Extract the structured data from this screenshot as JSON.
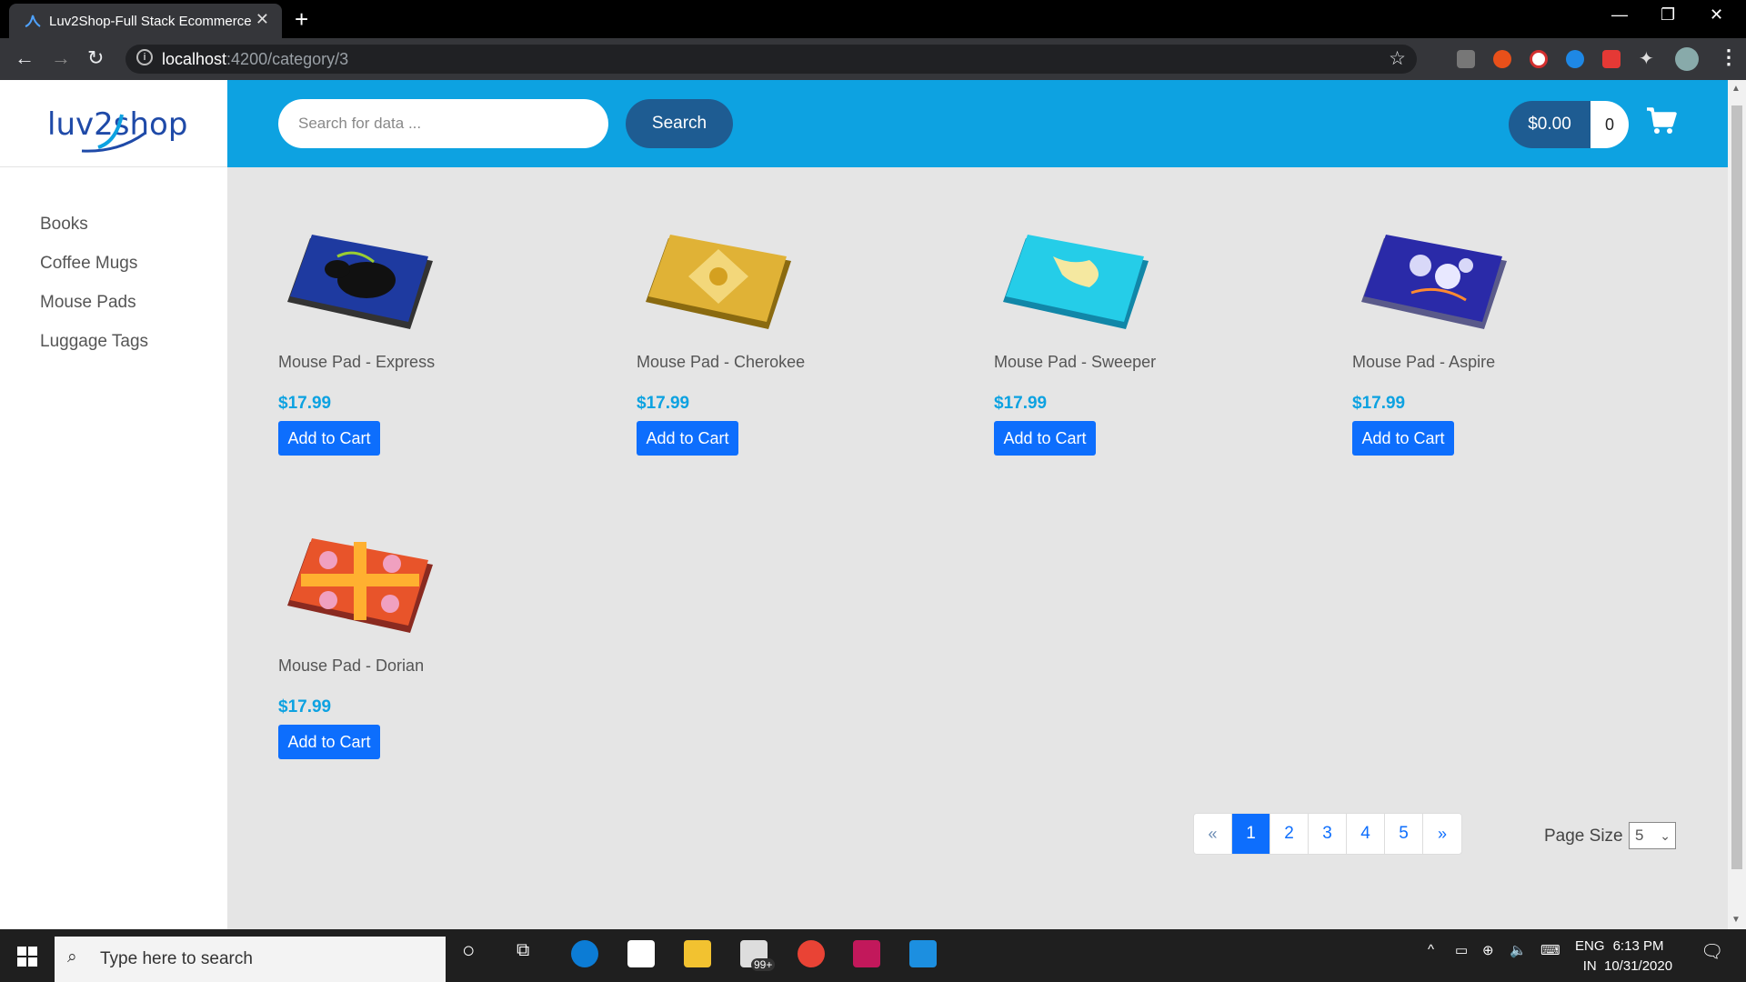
{
  "browser": {
    "tab_title": "Luv2Shop-Full Stack Ecommerce",
    "url_host": "localhost",
    "url_path": ":4200/category/3"
  },
  "app": {
    "logo_text": "luv2shop",
    "search": {
      "placeholder": "Search for data ...",
      "button_label": "Search"
    },
    "cart": {
      "total": "$0.00",
      "quantity": "0"
    },
    "categories": [
      "Books",
      "Coffee Mugs",
      "Mouse Pads",
      "Luggage Tags"
    ],
    "products": [
      {
        "name": "Mouse Pad - Express",
        "price": "$17.99",
        "button": "Add to Cart"
      },
      {
        "name": "Mouse Pad - Cherokee",
        "price": "$17.99",
        "button": "Add to Cart"
      },
      {
        "name": "Mouse Pad - Sweeper",
        "price": "$17.99",
        "button": "Add to Cart"
      },
      {
        "name": "Mouse Pad - Aspire",
        "price": "$17.99",
        "button": "Add to Cart"
      },
      {
        "name": "Mouse Pad - Dorian",
        "price": "$17.99",
        "button": "Add to Cart"
      }
    ],
    "pagination": {
      "prev": "«",
      "pages": [
        "1",
        "2",
        "3",
        "4",
        "5"
      ],
      "next": "»",
      "active_page": "1"
    },
    "page_size": {
      "label": "Page Size",
      "value": "5"
    }
  },
  "taskbar": {
    "search_placeholder": "Type here to search",
    "badge": "99+",
    "language": "ENG",
    "region": "IN",
    "time": "6:13 PM",
    "date": "10/31/2020"
  }
}
